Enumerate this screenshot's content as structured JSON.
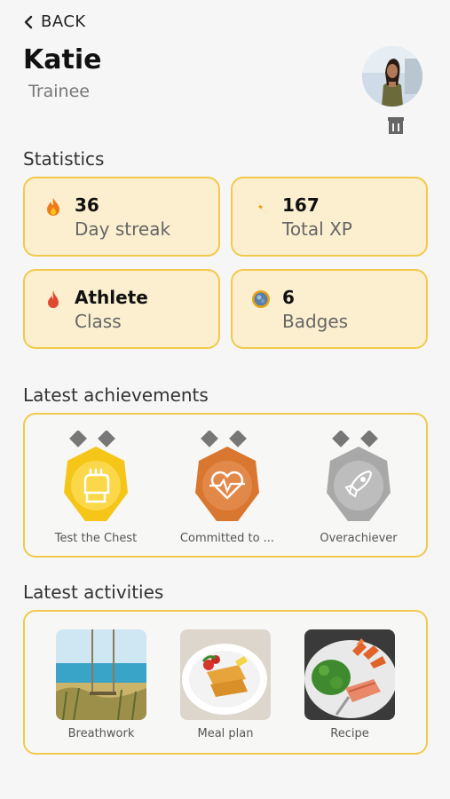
{
  "header": {
    "back_label": "BACK",
    "name": "Katie",
    "role": "Trainee"
  },
  "statistics": {
    "title": "Statistics",
    "cards": [
      {
        "value": "36",
        "label": "Day streak",
        "icon": "flame-icon"
      },
      {
        "value": "167",
        "label": "Total XP",
        "icon": "lightning-icon"
      },
      {
        "value": "Athlete",
        "label": "Class",
        "icon": "drop-flame-icon"
      },
      {
        "value": "6",
        "label": "Badges",
        "icon": "badge-icon"
      }
    ]
  },
  "achievements": {
    "title": "Latest achievements",
    "items": [
      {
        "label": "Test the Chest",
        "color": "#f5c518",
        "icon": "fist-icon"
      },
      {
        "label": "Committed to ...",
        "color": "#d9762f",
        "icon": "heart-pulse-icon"
      },
      {
        "label": "Overachiever",
        "color": "#a8a8a8",
        "icon": "rocket-icon"
      }
    ]
  },
  "activities": {
    "title": "Latest activities",
    "items": [
      {
        "label": "Breathwork"
      },
      {
        "label": "Meal plan"
      },
      {
        "label": "Recipe"
      }
    ]
  },
  "colors": {
    "accent_border": "#f2c94c",
    "card_bg": "#fbefcf",
    "background": "#f6f6f6"
  }
}
